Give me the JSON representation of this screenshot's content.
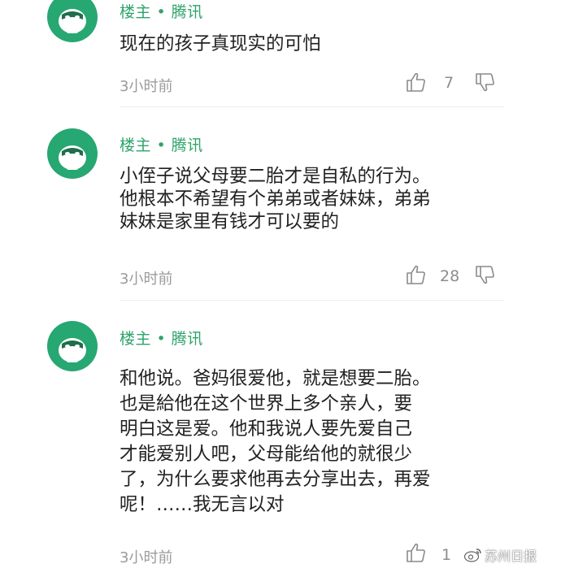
{
  "comments": [
    {
      "author": "楼主 • 腾讯",
      "lines": [
        "现在的孩子真现实的可怕"
      ],
      "time": "3小时前",
      "likes": "7"
    },
    {
      "author": "楼主 • 腾讯",
      "lines": [
        "小侄子说父母要二胎才是自私的行为。",
        "他根本不希望有个弟弟或者妹妹，弟弟",
        "妹妹是家里有钱才可以要的"
      ],
      "time": "3小时前",
      "likes": "28"
    },
    {
      "author": "楼主 • 腾讯",
      "lines": [
        "和他说。爸妈很爱他，就是想要二胎。",
        "也是給他在这个世界上多个亲人，要",
        "明白这是爱。他和我说人要先爱自己",
        "才能爱别人吧，父母能给他的就很少",
        "了，为什么要求他再去分享出去，再爱",
        "呢！……我无言以对"
      ],
      "time": "3小时前",
      "likes": "1"
    }
  ],
  "watermark": {
    "text": "苏州日报",
    "icon": "weibo-icon"
  },
  "colors": {
    "accent": "#2fa36b",
    "avatar": "#27a772",
    "body_text": "#222222",
    "meta_text": "#9b9b9b"
  }
}
